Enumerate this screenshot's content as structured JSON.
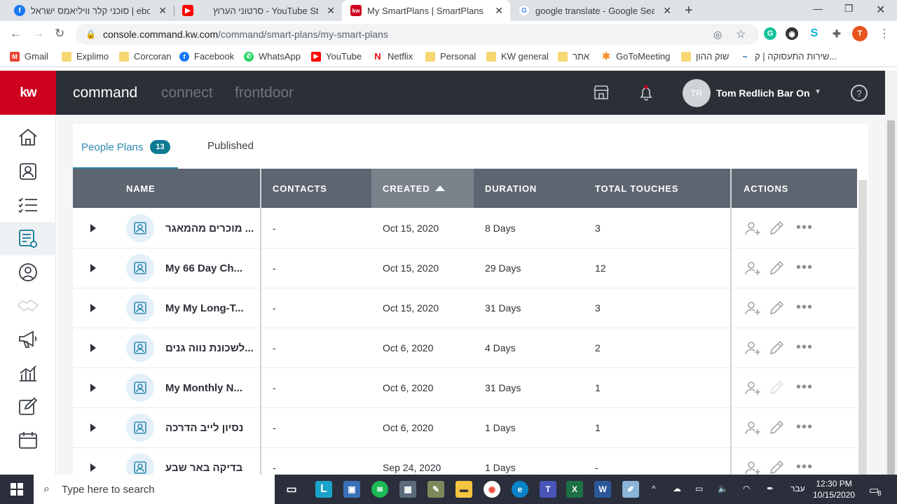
{
  "browser": {
    "tabs": [
      {
        "title": "סוכני קלר וויליאמס ישראל | ebook",
        "icon": "facebook-favicon",
        "color": "#1877f2",
        "glyph": "f",
        "active": false
      },
      {
        "title": "סרטוני הערוץ - YouTube Studio",
        "icon": "youtube-favicon",
        "color": "#ff0000",
        "glyph": "▶",
        "active": false
      },
      {
        "title": "My SmartPlans | SmartPlans",
        "icon": "kw-favicon",
        "color": "#ce011f",
        "glyph": "kw",
        "active": true
      },
      {
        "title": "google translate - Google Search",
        "icon": "google-favicon",
        "color": "#4285f4",
        "glyph": "G",
        "active": false
      }
    ],
    "url_host": "console.command.kw.com",
    "url_path": "/command/smart-plans/my-smart-plans",
    "bookmarks": [
      {
        "label": "Gmail",
        "color": "#ea4335",
        "glyph": "M"
      },
      {
        "label": "Explimo",
        "color": "#f7d774",
        "glyph": ""
      },
      {
        "label": "Corcoran",
        "color": "#f7d774",
        "glyph": ""
      },
      {
        "label": "Facebook",
        "color": "#1877f2",
        "glyph": "f"
      },
      {
        "label": "WhatsApp",
        "color": "#25d366",
        "glyph": "✆"
      },
      {
        "label": "YouTube",
        "color": "#ff0000",
        "glyph": "▶"
      },
      {
        "label": "Netflix",
        "color": "#e50914",
        "glyph": "N"
      },
      {
        "label": "Personal",
        "color": "#f7d774",
        "glyph": ""
      },
      {
        "label": "KW general",
        "color": "#f7d774",
        "glyph": ""
      },
      {
        "label": "אתר",
        "color": "#f7d774",
        "glyph": ""
      },
      {
        "label": "GoToMeeting",
        "color": "#f68d2e",
        "glyph": "✱"
      },
      {
        "label": "שוק ההון",
        "color": "#f7d774",
        "glyph": ""
      },
      {
        "label": "שירות התעסוקה | ק...",
        "color": "#1a5fa8",
        "glyph": "~"
      }
    ]
  },
  "app": {
    "logo": "kw",
    "nav": [
      "command",
      "connect",
      "frontdoor"
    ],
    "user": {
      "initials": "TR",
      "name": "Tom Redlich Bar On"
    },
    "help": "?"
  },
  "plans": {
    "tabs": [
      {
        "label": "People Plans",
        "badge": "13"
      },
      {
        "label": "Published"
      }
    ],
    "columns": [
      "NAME",
      "CONTACTS",
      "CREATED",
      "DURATION",
      "TOTAL TOUCHES",
      "ACTIONS"
    ],
    "rows": [
      {
        "name": "מוכרים מהמאגר ...",
        "contacts": "-",
        "created": "Oct 15, 2020",
        "duration": "8 Days",
        "touches": "3"
      },
      {
        "name": "My 66 Day Ch...",
        "contacts": "-",
        "created": "Oct 15, 2020",
        "duration": "29 Days",
        "touches": "12"
      },
      {
        "name": "My My Long-T...",
        "contacts": "-",
        "created": "Oct 15, 2020",
        "duration": "31 Days",
        "touches": "3"
      },
      {
        "name": "לשכונת נווה גנים...",
        "contacts": "-",
        "created": "Oct 6, 2020",
        "duration": "4 Days",
        "touches": "2"
      },
      {
        "name": "My Monthly N...",
        "contacts": "-",
        "created": "Oct 6, 2020",
        "duration": "31 Days",
        "touches": "1"
      },
      {
        "name": "נסיון לייב הדרכה",
        "contacts": "-",
        "created": "Oct 6, 2020",
        "duration": "1 Days",
        "touches": "1"
      },
      {
        "name": "בדיקה באר שבע",
        "contacts": "-",
        "created": "Sep 24, 2020",
        "duration": "1 Days",
        "touches": "-"
      }
    ]
  },
  "taskbar": {
    "search_placeholder": "Type here to search",
    "lang": "עבר",
    "time": "12:30 PM",
    "date": "10/15/2020",
    "notifications": "8"
  }
}
